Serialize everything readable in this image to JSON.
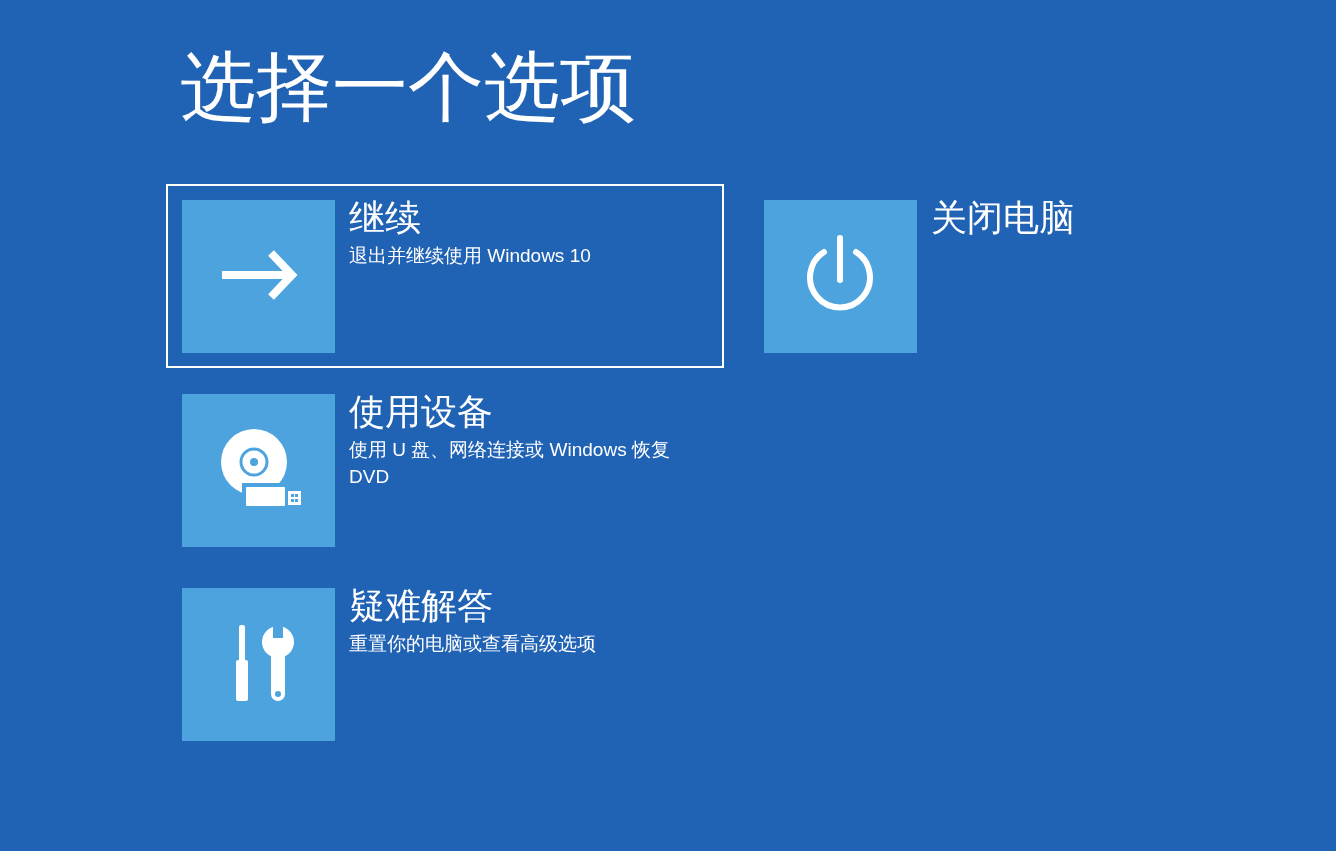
{
  "title": "选择一个选项",
  "columns": [
    {
      "options": [
        {
          "kind": "arrow",
          "title": "继续",
          "description": "退出并继续使用 Windows 10",
          "selected": true
        },
        {
          "kind": "device",
          "title": "使用设备",
          "description": "使用 U 盘、网络连接或 Windows 恢复 DVD",
          "selected": false
        },
        {
          "kind": "tools",
          "title": "疑难解答",
          "description": "重置你的电脑或查看高级选项",
          "selected": false
        }
      ]
    },
    {
      "options": [
        {
          "kind": "power",
          "title": "关闭电脑",
          "selected": false
        }
      ]
    }
  ]
}
